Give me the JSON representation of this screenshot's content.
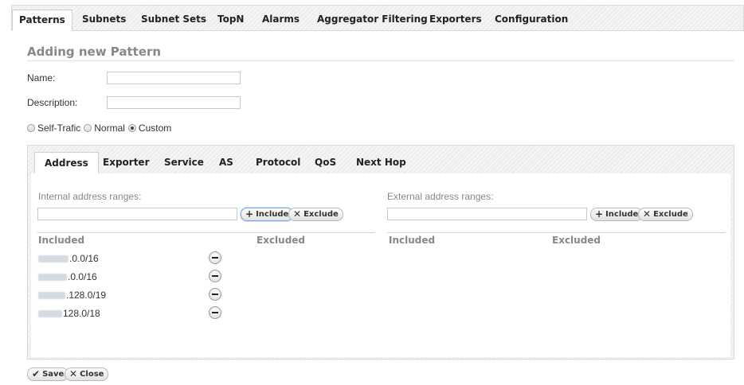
{
  "top_tabs": [
    {
      "label": "Patterns",
      "active": true
    },
    {
      "label": "Subnets"
    },
    {
      "label": "Subnet Sets"
    },
    {
      "label": "TopN"
    },
    {
      "label": "Alarms"
    },
    {
      "label": "Aggregator Filtering"
    },
    {
      "label": "Exporters"
    },
    {
      "label": "Configuration"
    }
  ],
  "form": {
    "title": "Adding new Pattern",
    "name_label": "Name:",
    "name_value": "",
    "description_label": "Description:",
    "description_value": ""
  },
  "traffic_options": [
    {
      "label": "Self-Trafic",
      "checked": false
    },
    {
      "label": "Normal",
      "checked": false
    },
    {
      "label": "Custom",
      "checked": true
    }
  ],
  "sub_tabs": [
    {
      "label": "Address",
      "active": true
    },
    {
      "label": "Exporter"
    },
    {
      "label": "Service"
    },
    {
      "label": "AS"
    },
    {
      "label": "Protocol"
    },
    {
      "label": "QoS"
    },
    {
      "label": "Next Hop"
    }
  ],
  "internal": {
    "label": "Internal address ranges:",
    "input_value": "",
    "include_label": "Include",
    "exclude_label": "Exclude",
    "included_header": "Included",
    "excluded_header": "Excluded",
    "included": [
      ".0.0/16",
      ".0.0/16",
      ".128.0/19",
      "128.0/18"
    ]
  },
  "external": {
    "label": "External address ranges:",
    "input_value": "",
    "include_label": "Include",
    "exclude_label": "Exclude",
    "included_header": "Included",
    "excluded_header": "Excluded"
  },
  "footer": {
    "save_label": "Save",
    "close_label": "Close"
  },
  "icons": {
    "include": "plus-icon",
    "exclude": "x-icon",
    "remove": "minus-circle-icon",
    "save": "checkmark-icon",
    "close": "x-icon"
  }
}
